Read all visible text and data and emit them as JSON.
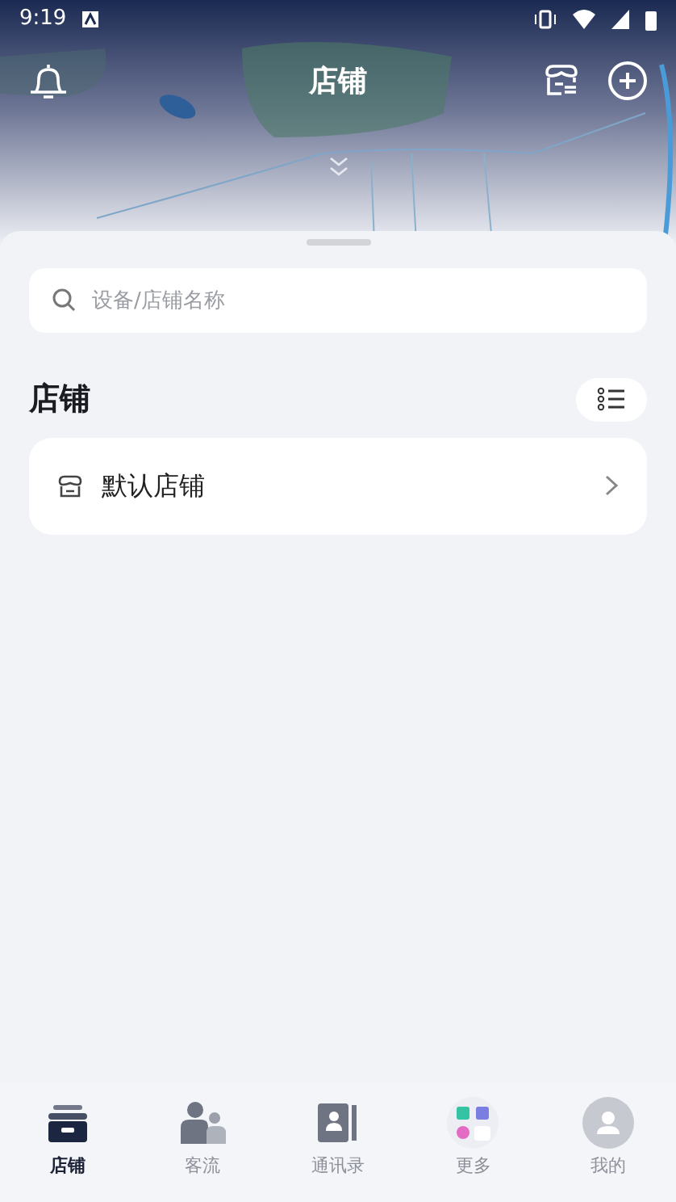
{
  "status_bar": {
    "time": "9:19"
  },
  "header": {
    "title": "店铺"
  },
  "search": {
    "placeholder": "设备/店铺名称"
  },
  "section": {
    "title": "店铺"
  },
  "stores": [
    {
      "name": "默认店铺"
    }
  ],
  "tabs": [
    {
      "label": "店铺",
      "selected": true
    },
    {
      "label": "客流",
      "selected": false
    },
    {
      "label": "通讯录",
      "selected": false
    },
    {
      "label": "更多",
      "selected": false
    },
    {
      "label": "我的",
      "selected": false
    }
  ]
}
